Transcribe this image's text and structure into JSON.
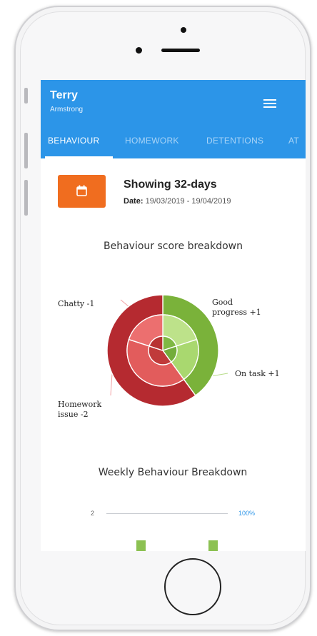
{
  "user": {
    "first_name": "Terry",
    "last_name": "Armstrong"
  },
  "icons": {
    "menu": "hamburger-menu-icon",
    "calendar": "calendar-icon"
  },
  "tabs": [
    {
      "label": "BEHAVIOUR",
      "active": true
    },
    {
      "label": "HOMEWORK",
      "active": false
    },
    {
      "label": "DETENTIONS",
      "active": false
    },
    {
      "label": "AT",
      "active": false
    }
  ],
  "summary": {
    "showing": "Showing 32-days",
    "date_label": "Date:",
    "date_range": "19/03/2019 - 19/04/2019"
  },
  "colors": {
    "header": "#2c95e8",
    "calendar_button": "#f06d1f",
    "positive": "#8cc152",
    "negative": "#c0292f"
  },
  "chart_data": [
    {
      "type": "pie",
      "title": "Behaviour score breakdown",
      "style": "sunburst",
      "slices": [
        {
          "label": "Good progress",
          "value": 1
        },
        {
          "label": "On task",
          "value": 1
        },
        {
          "label": "Homework issue",
          "value": -2
        },
        {
          "label": "Chatty",
          "value": -1
        }
      ],
      "labels": [
        "Good progress +1",
        "On task +1",
        "Homework issue -2",
        "Chatty -1"
      ]
    },
    {
      "type": "bar",
      "title": "Weekly Behaviour Breakdown",
      "y_tick_left": "2",
      "y_tick_right": "100%",
      "values": [
        2,
        2
      ]
    }
  ]
}
